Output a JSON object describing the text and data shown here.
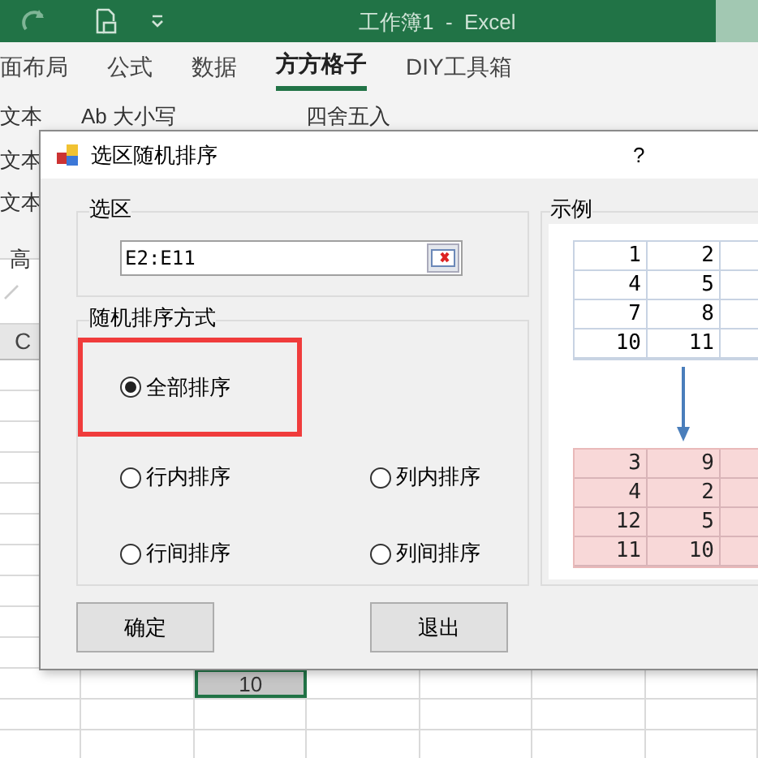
{
  "window": {
    "title": "工作簿1  -  Excel"
  },
  "ribbon_tabs": [
    {
      "label": "面布局",
      "selected": false
    },
    {
      "label": "公式",
      "selected": false
    },
    {
      "label": "数据",
      "selected": false
    },
    {
      "label": "方方格子",
      "selected": true
    },
    {
      "label": "DIY工具箱",
      "selected": false
    }
  ],
  "ribbon": {
    "left_items": [
      "文本",
      "文本",
      "文本",
      "高"
    ],
    "case_button": "Ab 大小写",
    "round_button": "四舍五入"
  },
  "sheet": {
    "column_header": "C",
    "selected_cell": "10"
  },
  "dialog": {
    "title": "选区随机排序",
    "help": "?",
    "range_group": {
      "label": "选区",
      "value": "E2:E11"
    },
    "mode_group": {
      "label": "随机排序方式",
      "options": [
        {
          "label": "全部排序",
          "selected": true,
          "highlighted": true
        },
        {
          "label": "行内排序",
          "selected": false,
          "highlighted": false
        },
        {
          "label": "列内排序",
          "selected": false,
          "highlighted": false
        },
        {
          "label": "行间排序",
          "selected": false,
          "highlighted": false
        },
        {
          "label": "列间排序",
          "selected": false,
          "highlighted": false
        }
      ]
    },
    "example": {
      "label": "示例",
      "before": [
        [
          "1",
          "2"
        ],
        [
          "4",
          "5"
        ],
        [
          "7",
          "8"
        ],
        [
          "10",
          "11"
        ]
      ],
      "after": [
        [
          "3",
          "9"
        ],
        [
          "4",
          "2"
        ],
        [
          "12",
          "5"
        ],
        [
          "11",
          "10"
        ]
      ]
    },
    "buttons": [
      "确定",
      "退出"
    ]
  }
}
